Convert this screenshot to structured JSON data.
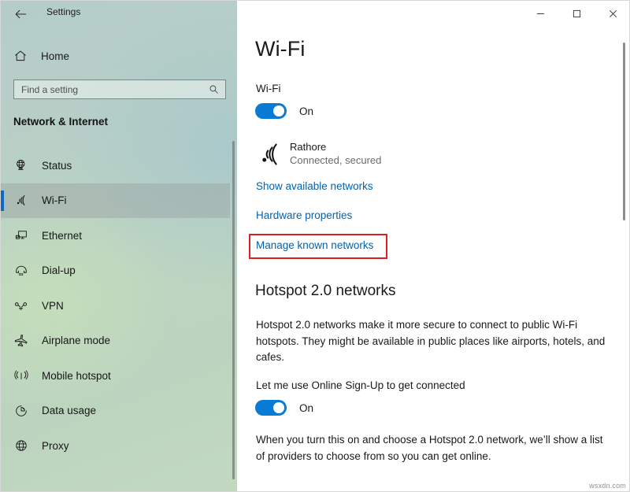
{
  "window": {
    "title": "Settings",
    "back_icon": "back-arrow-icon",
    "controls": {
      "minimize": "─",
      "maximize": "□",
      "close": "✕"
    }
  },
  "sidebar": {
    "home": {
      "label": "Home",
      "icon": "home-icon"
    },
    "search": {
      "value": "",
      "placeholder": "Find a setting",
      "icon": "search-icon"
    },
    "section_heading": "Network & Internet",
    "items": [
      {
        "label": "Status",
        "icon": "globe-status-icon",
        "selected": false
      },
      {
        "label": "Wi-Fi",
        "icon": "wifi-icon",
        "selected": true
      },
      {
        "label": "Ethernet",
        "icon": "monitor-icon",
        "selected": false
      },
      {
        "label": "Dial-up",
        "icon": "phone-icon",
        "selected": false
      },
      {
        "label": "VPN",
        "icon": "vpn-icon",
        "selected": false
      },
      {
        "label": "Airplane mode",
        "icon": "airplane-icon",
        "selected": false
      },
      {
        "label": "Mobile hotspot",
        "icon": "hotspot-icon",
        "selected": false
      },
      {
        "label": "Data usage",
        "icon": "pie-chart-icon",
        "selected": false
      },
      {
        "label": "Proxy",
        "icon": "globe-proxy-icon",
        "selected": false
      }
    ]
  },
  "main": {
    "page_title": "Wi-Fi",
    "wifi_toggle": {
      "label": "Wi-Fi",
      "state": "On",
      "on": true
    },
    "network": {
      "name": "Rathore",
      "status": "Connected, secured",
      "icon": "wifi-connected-icon"
    },
    "links": [
      {
        "label": "Show available networks",
        "highlighted": false
      },
      {
        "label": "Hardware properties",
        "highlighted": false
      },
      {
        "label": "Manage known networks",
        "highlighted": true
      }
    ],
    "hotspot": {
      "heading": "Hotspot 2.0 networks",
      "description": "Hotspot 2.0 networks make it more secure to connect to public Wi-Fi hotspots. They might be available in public places like airports, hotels, and cafes.",
      "osu_label": "Let me use Online Sign-Up to get connected",
      "osu_toggle": {
        "state": "On",
        "on": true
      },
      "osu_description": "When you turn this on and choose a Hotspot 2.0 network, we’ll show a list of providers to choose from so you can get online."
    }
  },
  "annotation": {
    "color": "#e02020",
    "target": "Manage known networks"
  },
  "watermark": "wsxdn.com"
}
